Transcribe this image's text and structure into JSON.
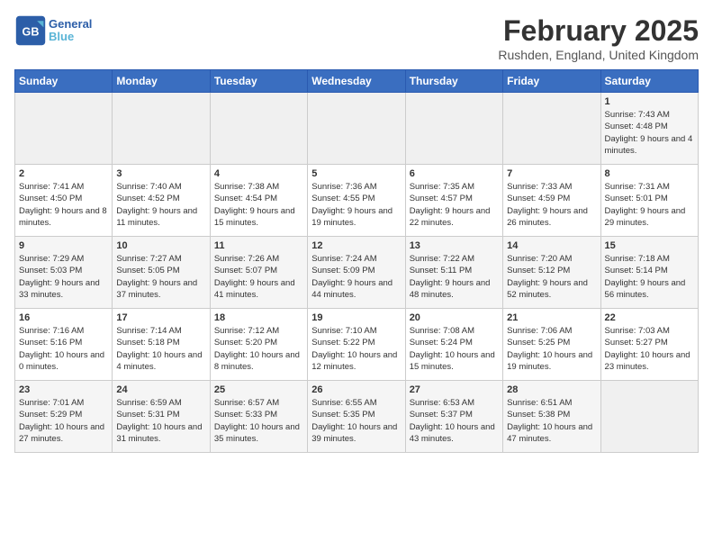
{
  "header": {
    "logo_text_general": "General",
    "logo_text_blue": "Blue",
    "month": "February 2025",
    "location": "Rushden, England, United Kingdom"
  },
  "days_of_week": [
    "Sunday",
    "Monday",
    "Tuesday",
    "Wednesday",
    "Thursday",
    "Friday",
    "Saturday"
  ],
  "weeks": [
    [
      {
        "day": null,
        "sunrise": null,
        "sunset": null,
        "daylight": null
      },
      {
        "day": null,
        "sunrise": null,
        "sunset": null,
        "daylight": null
      },
      {
        "day": null,
        "sunrise": null,
        "sunset": null,
        "daylight": null
      },
      {
        "day": null,
        "sunrise": null,
        "sunset": null,
        "daylight": null
      },
      {
        "day": null,
        "sunrise": null,
        "sunset": null,
        "daylight": null
      },
      {
        "day": null,
        "sunrise": null,
        "sunset": null,
        "daylight": null
      },
      {
        "day": "1",
        "sunrise": "7:43 AM",
        "sunset": "4:48 PM",
        "daylight": "9 hours and 4 minutes."
      }
    ],
    [
      {
        "day": "2",
        "sunrise": "7:41 AM",
        "sunset": "4:50 PM",
        "daylight": "9 hours and 8 minutes."
      },
      {
        "day": "3",
        "sunrise": "7:40 AM",
        "sunset": "4:52 PM",
        "daylight": "9 hours and 11 minutes."
      },
      {
        "day": "4",
        "sunrise": "7:38 AM",
        "sunset": "4:54 PM",
        "daylight": "9 hours and 15 minutes."
      },
      {
        "day": "5",
        "sunrise": "7:36 AM",
        "sunset": "4:55 PM",
        "daylight": "9 hours and 19 minutes."
      },
      {
        "day": "6",
        "sunrise": "7:35 AM",
        "sunset": "4:57 PM",
        "daylight": "9 hours and 22 minutes."
      },
      {
        "day": "7",
        "sunrise": "7:33 AM",
        "sunset": "4:59 PM",
        "daylight": "9 hours and 26 minutes."
      },
      {
        "day": "8",
        "sunrise": "7:31 AM",
        "sunset": "5:01 PM",
        "daylight": "9 hours and 29 minutes."
      }
    ],
    [
      {
        "day": "9",
        "sunrise": "7:29 AM",
        "sunset": "5:03 PM",
        "daylight": "9 hours and 33 minutes."
      },
      {
        "day": "10",
        "sunrise": "7:27 AM",
        "sunset": "5:05 PM",
        "daylight": "9 hours and 37 minutes."
      },
      {
        "day": "11",
        "sunrise": "7:26 AM",
        "sunset": "5:07 PM",
        "daylight": "9 hours and 41 minutes."
      },
      {
        "day": "12",
        "sunrise": "7:24 AM",
        "sunset": "5:09 PM",
        "daylight": "9 hours and 44 minutes."
      },
      {
        "day": "13",
        "sunrise": "7:22 AM",
        "sunset": "5:11 PM",
        "daylight": "9 hours and 48 minutes."
      },
      {
        "day": "14",
        "sunrise": "7:20 AM",
        "sunset": "5:12 PM",
        "daylight": "9 hours and 52 minutes."
      },
      {
        "day": "15",
        "sunrise": "7:18 AM",
        "sunset": "5:14 PM",
        "daylight": "9 hours and 56 minutes."
      }
    ],
    [
      {
        "day": "16",
        "sunrise": "7:16 AM",
        "sunset": "5:16 PM",
        "daylight": "10 hours and 0 minutes."
      },
      {
        "day": "17",
        "sunrise": "7:14 AM",
        "sunset": "5:18 PM",
        "daylight": "10 hours and 4 minutes."
      },
      {
        "day": "18",
        "sunrise": "7:12 AM",
        "sunset": "5:20 PM",
        "daylight": "10 hours and 8 minutes."
      },
      {
        "day": "19",
        "sunrise": "7:10 AM",
        "sunset": "5:22 PM",
        "daylight": "10 hours and 12 minutes."
      },
      {
        "day": "20",
        "sunrise": "7:08 AM",
        "sunset": "5:24 PM",
        "daylight": "10 hours and 15 minutes."
      },
      {
        "day": "21",
        "sunrise": "7:06 AM",
        "sunset": "5:25 PM",
        "daylight": "10 hours and 19 minutes."
      },
      {
        "day": "22",
        "sunrise": "7:03 AM",
        "sunset": "5:27 PM",
        "daylight": "10 hours and 23 minutes."
      }
    ],
    [
      {
        "day": "23",
        "sunrise": "7:01 AM",
        "sunset": "5:29 PM",
        "daylight": "10 hours and 27 minutes."
      },
      {
        "day": "24",
        "sunrise": "6:59 AM",
        "sunset": "5:31 PM",
        "daylight": "10 hours and 31 minutes."
      },
      {
        "day": "25",
        "sunrise": "6:57 AM",
        "sunset": "5:33 PM",
        "daylight": "10 hours and 35 minutes."
      },
      {
        "day": "26",
        "sunrise": "6:55 AM",
        "sunset": "5:35 PM",
        "daylight": "10 hours and 39 minutes."
      },
      {
        "day": "27",
        "sunrise": "6:53 AM",
        "sunset": "5:37 PM",
        "daylight": "10 hours and 43 minutes."
      },
      {
        "day": "28",
        "sunrise": "6:51 AM",
        "sunset": "5:38 PM",
        "daylight": "10 hours and 47 minutes."
      },
      {
        "day": null,
        "sunrise": null,
        "sunset": null,
        "daylight": null
      }
    ]
  ]
}
